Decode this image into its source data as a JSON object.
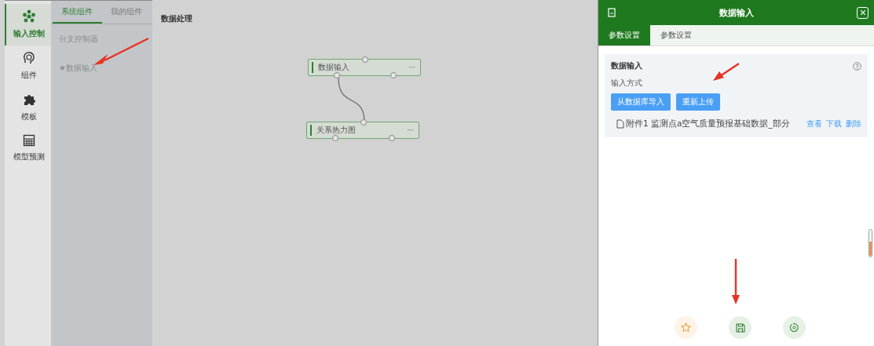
{
  "nav": [
    {
      "label": "输入控制",
      "selected": true
    },
    {
      "label": "组件",
      "selected": false
    },
    {
      "label": "模板",
      "selected": false
    },
    {
      "label": "模型预测",
      "selected": false
    }
  ],
  "component_tabs": [
    {
      "label": "系统组件",
      "selected": true
    },
    {
      "label": "我的组件",
      "selected": false
    }
  ],
  "component_list": [
    {
      "label": "分支控制器"
    },
    {
      "label": "★数据输入"
    }
  ],
  "canvas": {
    "title": "数据处理",
    "nodes": [
      {
        "label": "数据输入",
        "menu": "···"
      },
      {
        "label": "关系热力图",
        "menu": "···"
      }
    ]
  },
  "drawer": {
    "title": "数据输入",
    "tabs": [
      {
        "label": "参数设置",
        "selected": true
      },
      {
        "label": "参数设置",
        "selected": false
      }
    ],
    "section_title": "数据输入",
    "field_label": "输入方式",
    "buttons": [
      "从数据库导入",
      "重新上传"
    ],
    "attachment": {
      "name": "附件1 监测点a空气质量预报基础数据_部分",
      "actions": [
        "查看",
        "下载",
        "删除"
      ]
    },
    "footer_actions": [
      {
        "kind": "star"
      },
      {
        "kind": "save"
      },
      {
        "kind": "reset"
      }
    ]
  }
}
